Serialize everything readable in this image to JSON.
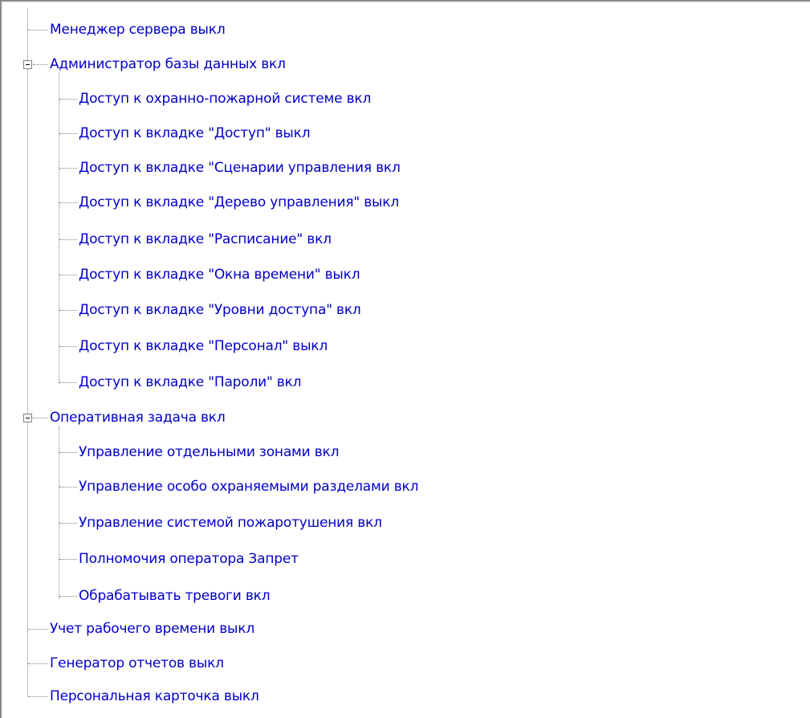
{
  "tree": {
    "items": [
      {
        "label": "Менеджер сервера  выкл"
      },
      {
        "label": "Администратор базы данных  вкл",
        "expanded": true,
        "children": [
          {
            "label": "Доступ к охранно-пожарной системе  вкл"
          },
          {
            "label": "Доступ к вкладке \"Доступ\"  выкл"
          },
          {
            "label": "Доступ к вкладке \"Сценарии управления  вкл"
          },
          {
            "label": "Доступ к вкладке \"Дерево управления\"  выкл"
          },
          {
            "label": "Доступ к вкладке \"Расписание\"  вкл"
          },
          {
            "label": "Доступ к вкладке \"Окна времени\"  выкл"
          },
          {
            "label": "Доступ к вкладке \"Уровни доступа\"  вкл"
          },
          {
            "label": "Доступ к вкладке \"Персонал\"  выкл"
          },
          {
            "label": "Доступ к вкладке \"Пароли\"  вкл"
          }
        ]
      },
      {
        "label": "Оперативная задача  вкл",
        "expanded": true,
        "children": [
          {
            "label": "Управление отдельными зонами  вкл"
          },
          {
            "label": "Управление особо охраняемыми разделами  вкл"
          },
          {
            "label": "Управление системой пожаротушения  вкл"
          },
          {
            "label": "Полномочия оператора  Запрет"
          },
          {
            "label": "Обрабатывать тревоги  вкл"
          }
        ]
      },
      {
        "label": "Учет рабочего времени  выкл"
      },
      {
        "label": "Генератор отчетов  выкл"
      },
      {
        "label": "Персональная карточка  выкл"
      }
    ]
  },
  "colors": {
    "label_text": "#0000c8",
    "tree_lines": "#7f7f7f",
    "background": "#ffffff"
  }
}
